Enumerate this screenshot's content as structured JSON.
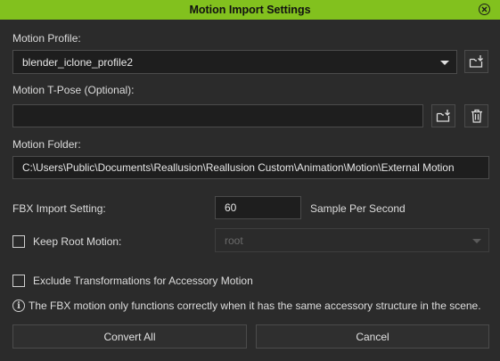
{
  "window": {
    "title": "Motion Import Settings",
    "close_icon": "close-circle-icon"
  },
  "motion_profile": {
    "label": "Motion Profile:",
    "selected": "blender_iclone_profile2",
    "load_icon": "folder-load-icon"
  },
  "tpose": {
    "label": "Motion T-Pose (Optional):",
    "value": "",
    "load_icon": "folder-load-icon",
    "delete_icon": "trash-icon"
  },
  "motion_folder": {
    "label": "Motion Folder:",
    "value": "C:\\Users\\Public\\Documents\\Reallusion\\Reallusion Custom\\Animation\\Motion\\External Motion"
  },
  "fbx_import": {
    "label": "FBX Import Setting:",
    "value": "60",
    "unit": "Sample Per Second"
  },
  "keep_root_motion": {
    "label": "Keep Root Motion:",
    "checked": false,
    "selected": "root",
    "disabled": true
  },
  "exclude_transform": {
    "label": "Exclude Transformations for Accessory Motion",
    "checked": false
  },
  "info": {
    "icon": "info-icon",
    "glyph": "i",
    "text": "The FBX motion only functions correctly when it has the same accessory structure in the scene."
  },
  "buttons": {
    "convert_all": "Convert All",
    "cancel": "Cancel"
  },
  "colors": {
    "title_bar": "#82c11e",
    "background": "#2b2b2b",
    "field": "#1e1e1e"
  }
}
